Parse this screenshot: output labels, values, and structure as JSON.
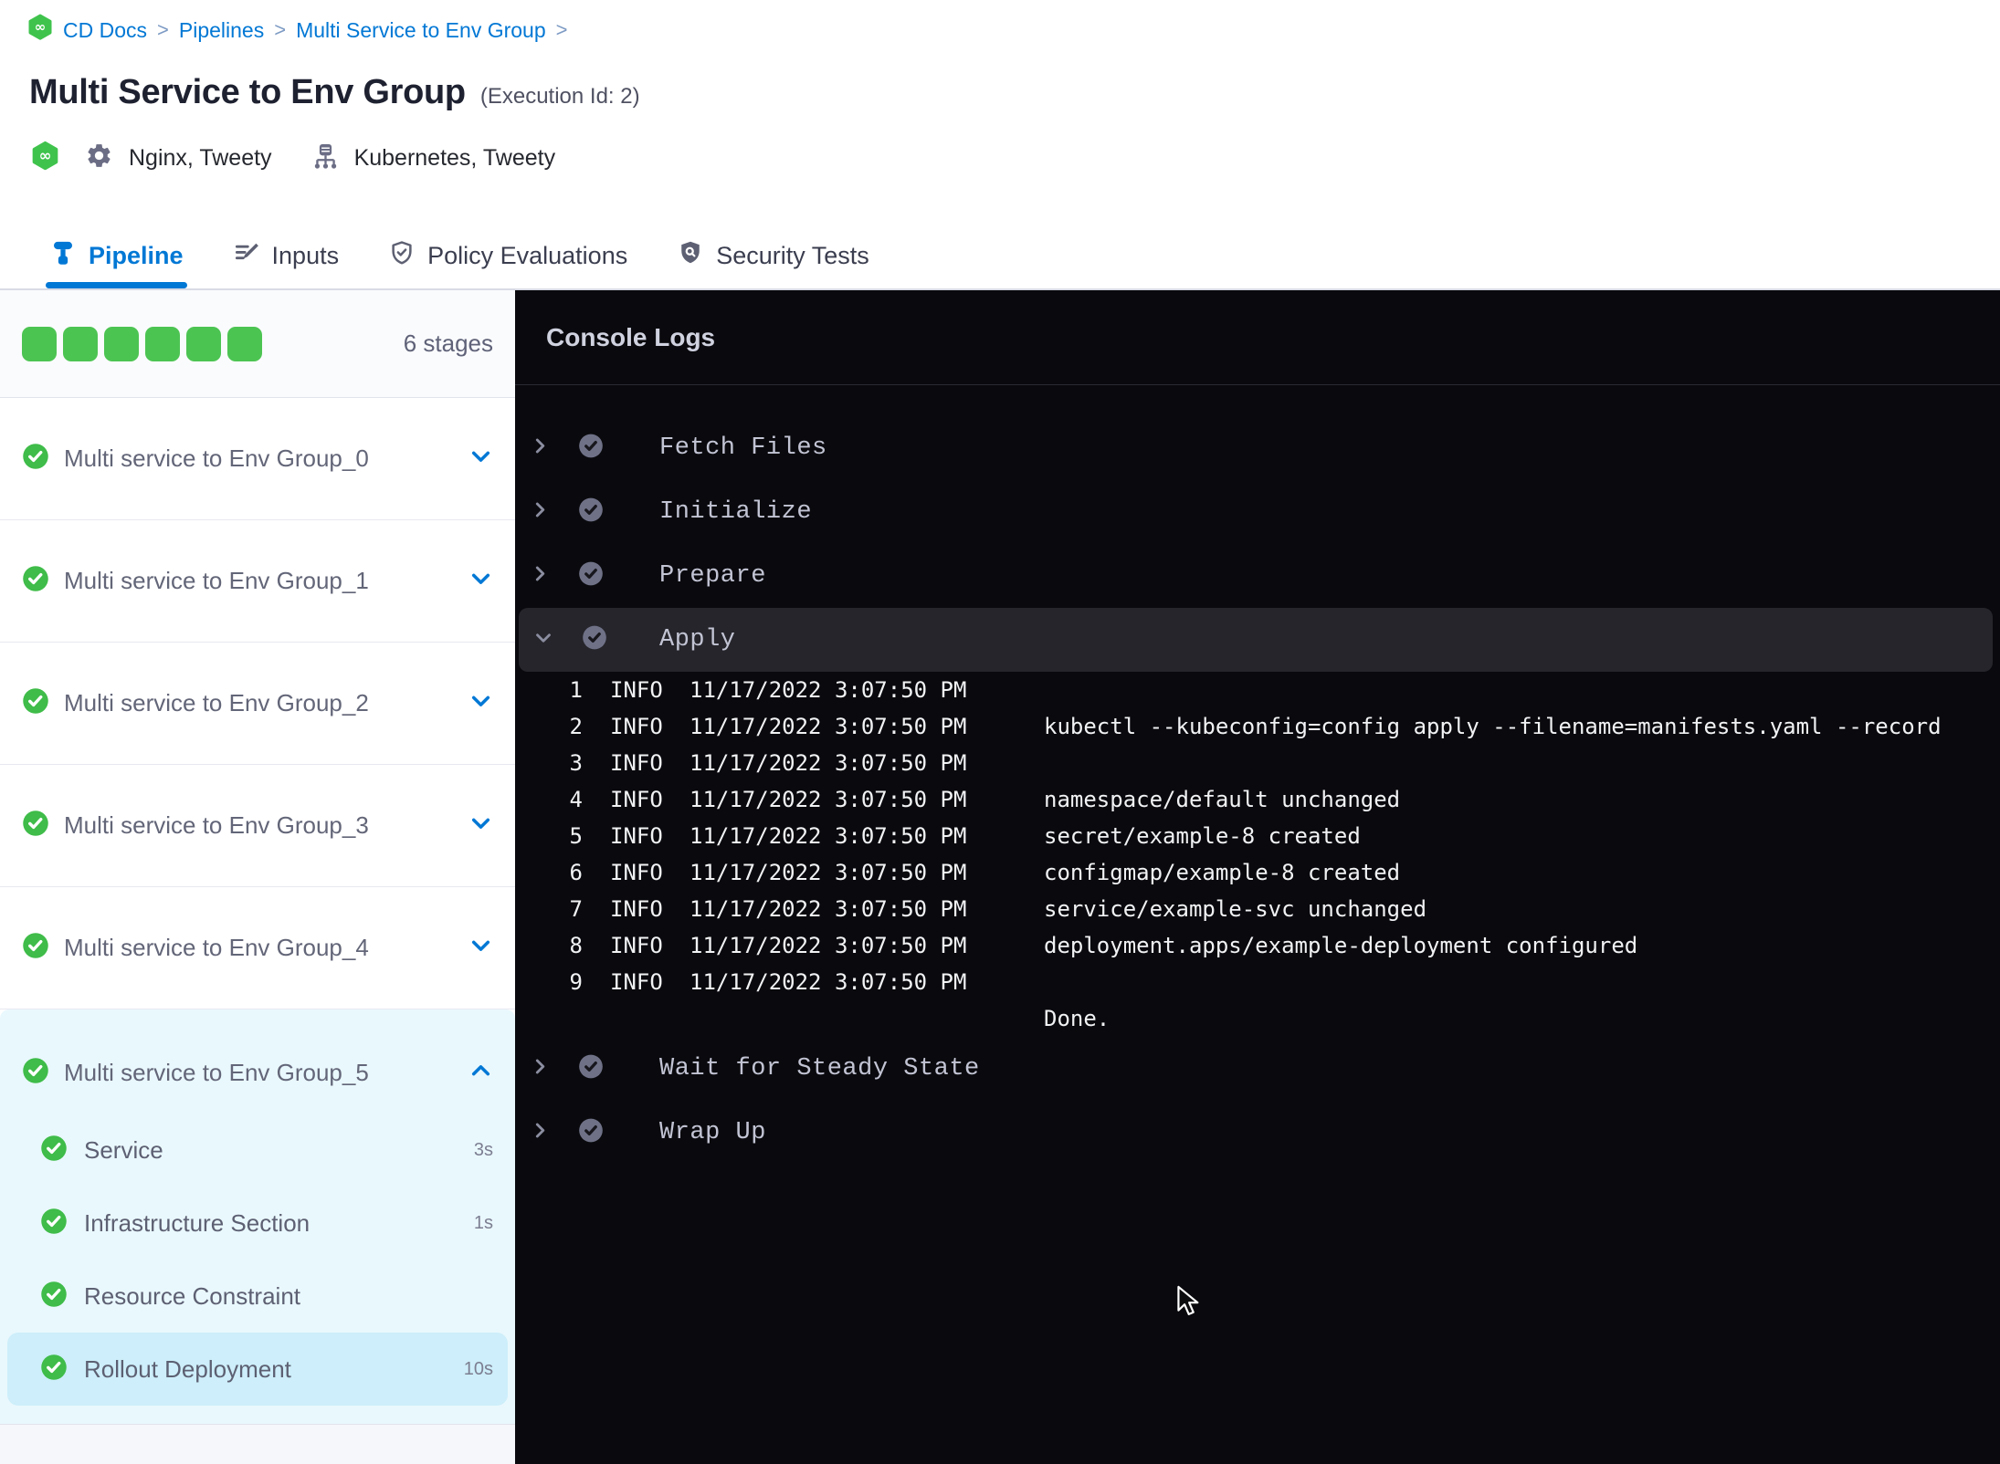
{
  "breadcrumb": {
    "items": [
      "CD Docs",
      "Pipelines",
      "Multi Service to Env Group"
    ],
    "separator": ">"
  },
  "header": {
    "title": "Multi Service to Env Group",
    "execution_id": "(Execution Id: 2)",
    "services_label": "Nginx, Tweety",
    "environments_label": "Kubernetes, Tweety"
  },
  "tabs": [
    {
      "label": "Pipeline",
      "icon": "pipeline-icon",
      "active": true
    },
    {
      "label": "Inputs",
      "icon": "inputs-icon",
      "active": false
    },
    {
      "label": "Policy Evaluations",
      "icon": "policy-evaluations-icon",
      "active": false
    },
    {
      "label": "Security Tests",
      "icon": "security-tests-icon",
      "active": false
    }
  ],
  "sidebar": {
    "stage_count_label": "6 stages",
    "completed_squares": 6,
    "stages": [
      {
        "label": "Multi service to Env Group_0",
        "status": "success",
        "expanded": false
      },
      {
        "label": "Multi service to Env Group_1",
        "status": "success",
        "expanded": false
      },
      {
        "label": "Multi service to Env Group_2",
        "status": "success",
        "expanded": false
      },
      {
        "label": "Multi service to Env Group_3",
        "status": "success",
        "expanded": false
      },
      {
        "label": "Multi service to Env Group_4",
        "status": "success",
        "expanded": false
      },
      {
        "label": "Multi service to Env Group_5",
        "status": "success",
        "expanded": true,
        "steps": [
          {
            "label": "Service",
            "duration": "3s",
            "selected": false
          },
          {
            "label": "Infrastructure Section",
            "duration": "1s",
            "selected": false
          },
          {
            "label": "Resource Constraint",
            "duration": "",
            "selected": false
          },
          {
            "label": "Rollout Deployment",
            "duration": "10s",
            "selected": true
          }
        ]
      }
    ]
  },
  "console": {
    "title": "Console Logs",
    "steps": [
      {
        "label": "Fetch Files",
        "status": "success",
        "expanded": false
      },
      {
        "label": "Initialize",
        "status": "success",
        "expanded": false
      },
      {
        "label": "Prepare",
        "status": "success",
        "expanded": false
      },
      {
        "label": "Apply",
        "status": "success",
        "expanded": true,
        "logs": [
          {
            "line": "1",
            "level": "INFO",
            "timestamp": "11/17/2022 3:07:50 PM",
            "message": ""
          },
          {
            "line": "2",
            "level": "INFO",
            "timestamp": "11/17/2022 3:07:50 PM",
            "message": "kubectl --kubeconfig=config apply --filename=manifests.yaml --record"
          },
          {
            "line": "3",
            "level": "INFO",
            "timestamp": "11/17/2022 3:07:50 PM",
            "message": ""
          },
          {
            "line": "4",
            "level": "INFO",
            "timestamp": "11/17/2022 3:07:50 PM",
            "message": "namespace/default unchanged"
          },
          {
            "line": "5",
            "level": "INFO",
            "timestamp": "11/17/2022 3:07:50 PM",
            "message": "secret/example-8 created"
          },
          {
            "line": "6",
            "level": "INFO",
            "timestamp": "11/17/2022 3:07:50 PM",
            "message": "configmap/example-8 created"
          },
          {
            "line": "7",
            "level": "INFO",
            "timestamp": "11/17/2022 3:07:50 PM",
            "message": "service/example-svc unchanged"
          },
          {
            "line": "8",
            "level": "INFO",
            "timestamp": "11/17/2022 3:07:50 PM",
            "message": "deployment.apps/example-deployment configured"
          },
          {
            "line": "9",
            "level": "INFO",
            "timestamp": "11/17/2022 3:07:50 PM",
            "message": ""
          },
          {
            "line": "",
            "level": "",
            "timestamp": "",
            "message": "Done."
          }
        ]
      },
      {
        "label": "Wait for Steady State",
        "status": "success",
        "expanded": false
      },
      {
        "label": "Wrap Up",
        "status": "success",
        "expanded": false
      }
    ]
  },
  "colors": {
    "accent_blue": "#0278d5",
    "success_green": "#3fbc49",
    "square_green": "#4cc452",
    "console_bg": "#0a0a0e",
    "apply_row_bg": "#25252b",
    "expanded_stage_bg": "#e9f8fd",
    "selected_step_bg": "#cdeefa"
  }
}
